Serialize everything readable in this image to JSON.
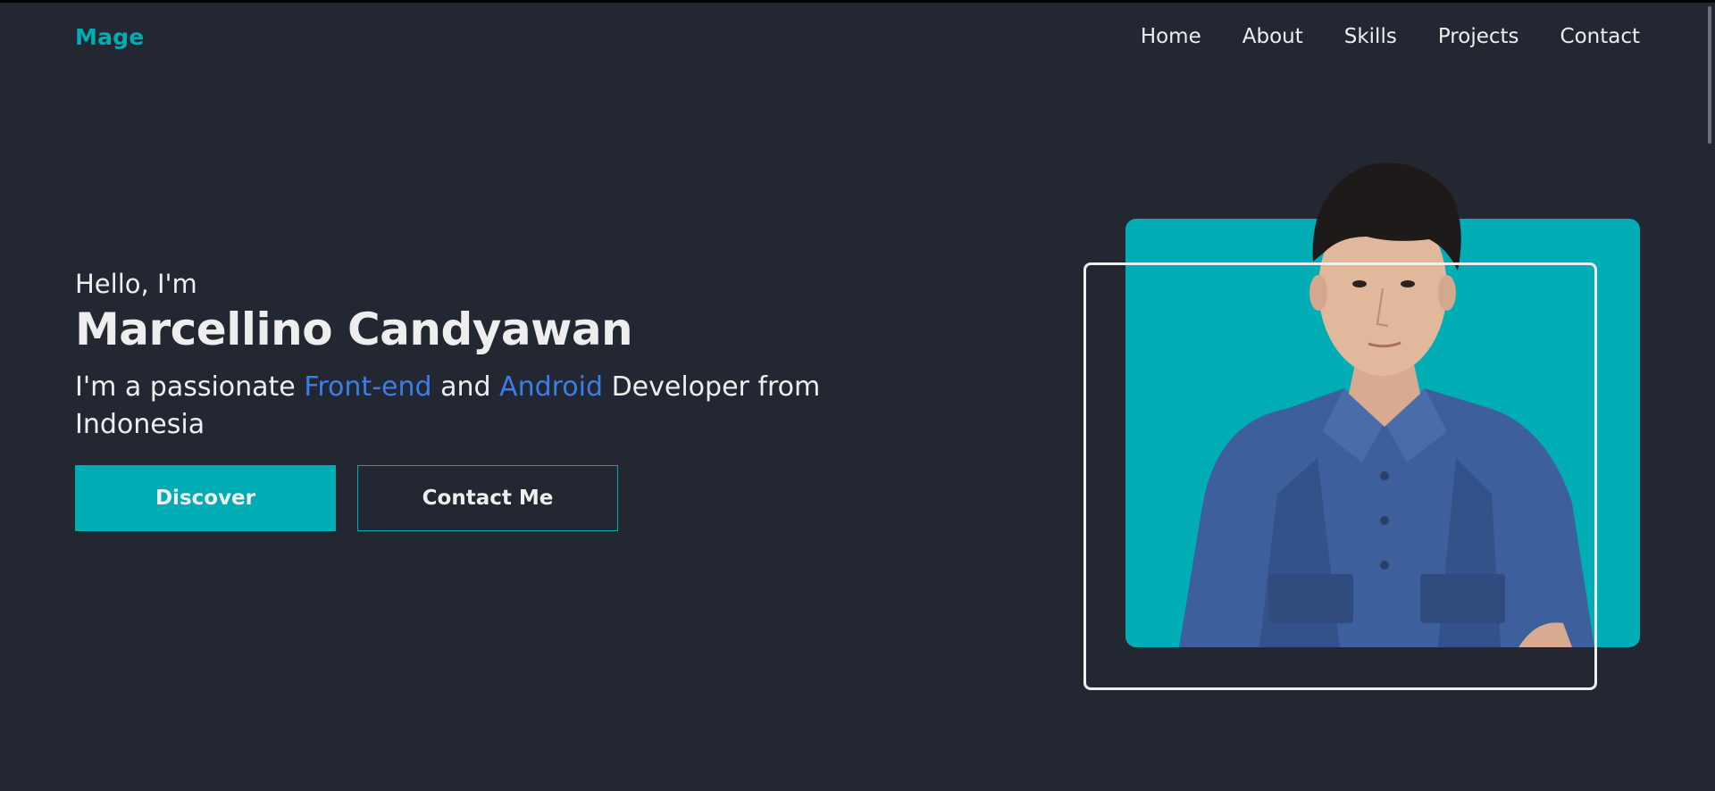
{
  "nav": {
    "logo": "Mage",
    "links": [
      {
        "label": "Home"
      },
      {
        "label": "About"
      },
      {
        "label": "Skills"
      },
      {
        "label": "Projects"
      },
      {
        "label": "Contact"
      }
    ]
  },
  "hero": {
    "greeting": "Hello, I'm",
    "name": "Marcellino Candyawan",
    "tagline": {
      "part1": "I'm a passionate ",
      "highlight1": "Front-end",
      "part2": " and ",
      "highlight2": "Android",
      "part3": " Developer from Indonesia"
    },
    "buttons": {
      "primary": "Discover",
      "secondary": "Contact Me"
    }
  },
  "colors": {
    "accent": "#00adb5",
    "background": "#222731",
    "text": "#eeeeee",
    "highlight": "#3b7de9"
  },
  "icons": {
    "portrait": "portrait-photo"
  }
}
